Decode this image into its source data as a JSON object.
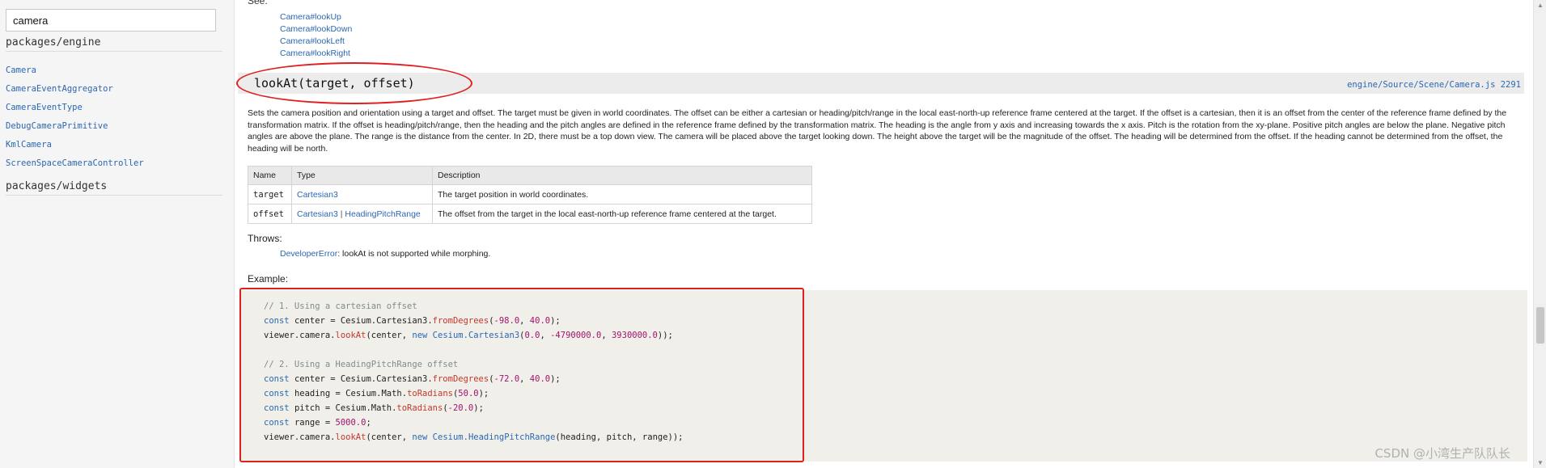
{
  "sidebar": {
    "search": {
      "value": "camera"
    },
    "groups": [
      {
        "title": "packages/engine",
        "items": [
          "Camera",
          "CameraEventAggregator",
          "CameraEventType",
          "DebugCameraPrimitive",
          "KmlCamera",
          "ScreenSpaceCameraController"
        ]
      },
      {
        "title": "packages/widgets",
        "items": []
      }
    ]
  },
  "main": {
    "see_label": "See:",
    "see_links": [
      "Camera#lookUp",
      "Camera#lookDown",
      "Camera#lookLeft",
      "Camera#lookRight"
    ],
    "signature": "lookAt(target, offset)",
    "source_link": "engine/Source/Scene/Camera.js 2291",
    "description": "Sets the camera position and orientation using a target and offset. The target must be given in world coordinates. The offset can be either a cartesian or heading/pitch/range in the local east-north-up reference frame centered at the target. If the offset is a cartesian, then it is an offset from the center of the reference frame defined by the transformation matrix. If the offset is heading/pitch/range, then the heading and the pitch angles are defined in the reference frame defined by the transformation matrix. The heading is the angle from y axis and increasing towards the x axis. Pitch is the rotation from the xy-plane. Positive pitch angles are below the plane. Negative pitch angles are above the plane. The range is the distance from the center. In 2D, there must be a top down view. The camera will be placed above the target looking down. The height above the target will be the magnitude of the offset. The heading will be determined from the offset. If the heading cannot be determined from the offset, the heading will be north.",
    "params_table": {
      "headers": [
        "Name",
        "Type",
        "Description"
      ],
      "rows": [
        {
          "name": "target",
          "types": [
            "Cartesian3"
          ],
          "description": "The target position in world coordinates."
        },
        {
          "name": "offset",
          "types": [
            "Cartesian3",
            "HeadingPitchRange"
          ],
          "description": "The offset from the target in the local east-north-up reference frame centered at the target."
        }
      ],
      "type_separator": "|"
    },
    "throws_label": "Throws:",
    "throws": {
      "type": "DeveloperError",
      "text": ": lookAt is not supported while morphing."
    },
    "example_label": "Example:",
    "code": {
      "comment1": "// 1. Using a cartesian offset",
      "comment2": "// 2. Using a HeadingPitchRange offset",
      "kw_const": "const",
      "kw_new": "new",
      "center": "center",
      "eq": " = ",
      "cesium": "Cesium",
      "cartesian3": "Cartesian3",
      "fromDegrees": "fromDegrees",
      "math": "Math",
      "toRadians": "toRadians",
      "viewer_camera": "viewer.camera.",
      "lookAt": "lookAt",
      "hpr": "HeadingPitchRange",
      "heading": "heading",
      "pitch": "pitch",
      "range": "range",
      "n1": "-98.0",
      "n2": "40.0",
      "n3": "0.0",
      "n4": "-4790000.0",
      "n5": "3930000.0",
      "n6": "-72.0",
      "n7": "40.0",
      "n8": "50.0",
      "n9": "-20.0",
      "n10": "5000.0"
    }
  },
  "watermark": "CSDN @小湾生产队队长",
  "colors": {
    "highlight": "#e02020",
    "link": "#2b67b1",
    "param_name": "#a0522d"
  }
}
